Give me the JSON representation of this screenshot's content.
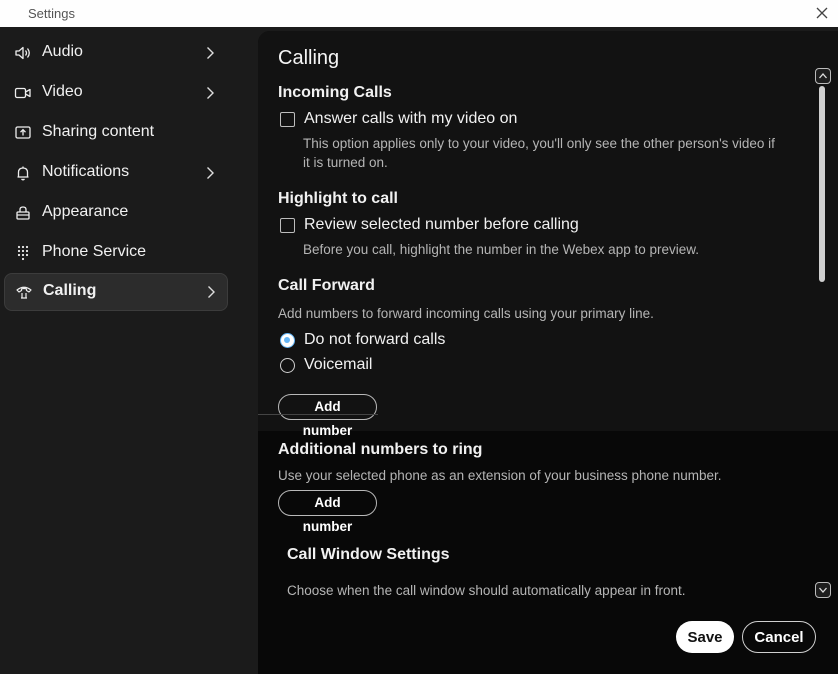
{
  "window": {
    "title": "Settings"
  },
  "sidebar": {
    "items": [
      {
        "label": "Audio",
        "icon": "speaker-icon",
        "has_chevron": true,
        "active": false
      },
      {
        "label": "Video",
        "icon": "video-camera-icon",
        "has_chevron": true,
        "active": false
      },
      {
        "label": "Sharing content",
        "icon": "share-screen-icon",
        "has_chevron": false,
        "active": false
      },
      {
        "label": "Notifications",
        "icon": "bell-icon",
        "has_chevron": true,
        "active": false
      },
      {
        "label": "Appearance",
        "icon": "palette-icon",
        "has_chevron": false,
        "active": false
      },
      {
        "label": "Phone Service",
        "icon": "dialpad-icon",
        "has_chevron": false,
        "active": false
      },
      {
        "label": "Calling",
        "icon": "phone-handset-icon",
        "has_chevron": true,
        "active": true
      }
    ]
  },
  "panel": {
    "title": "Calling",
    "incoming": {
      "heading": "Incoming Calls",
      "checkbox_label": "Answer calls with my video on",
      "checked": false,
      "desc_line1": "This option applies only to your video, you'll only see the other person's video if",
      "desc_line2": "it is turned on."
    },
    "highlight": {
      "heading": "Highlight to call",
      "checkbox_label": "Review selected number before calling",
      "checked": false,
      "desc": "Before you call, highlight the number in the Webex app to preview."
    },
    "forward": {
      "heading": "Call Forward",
      "desc": "Add numbers to forward incoming calls using your primary line.",
      "options": [
        "Do not forward calls",
        "Voicemail"
      ],
      "selected": "Do not forward calls",
      "add_label": "Add number"
    },
    "additional": {
      "heading": "Additional numbers to ring",
      "desc": "Use your selected phone as an extension of your business phone number.",
      "add_label": "Add number"
    },
    "window_settings": {
      "heading": "Call Window Settings",
      "desc": "Choose when the call window should automatically appear in front."
    }
  },
  "footer": {
    "save": "Save",
    "cancel": "Cancel"
  },
  "colors": {
    "accent": "#64b5f6",
    "panel_bg": "#121212",
    "sidebar_bg": "#1b1b1b"
  }
}
